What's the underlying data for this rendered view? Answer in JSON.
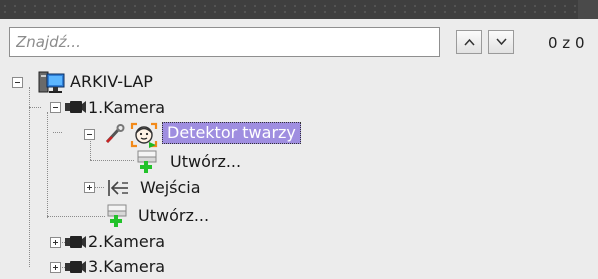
{
  "search": {
    "placeholder": "Znajdź..."
  },
  "counter": {
    "text": "0 z 0"
  },
  "tree": {
    "computer": {
      "label": "ARKIV-LAP"
    },
    "camera1": {
      "label": "1.Kamera"
    },
    "face_detector": {
      "label": "Detektor twarzy"
    },
    "create_under_detector": {
      "label": "Utwórz..."
    },
    "inputs": {
      "label": "Wejścia"
    },
    "create_under_camera": {
      "label": "Utwórz..."
    },
    "camera2": {
      "label": "2.Kamera"
    },
    "camera3": {
      "label": "3.Kamera"
    }
  },
  "colors": {
    "selection": "#9f8ee0",
    "create_plus": "#22c22a",
    "titlebar": "#3f3f3f"
  }
}
